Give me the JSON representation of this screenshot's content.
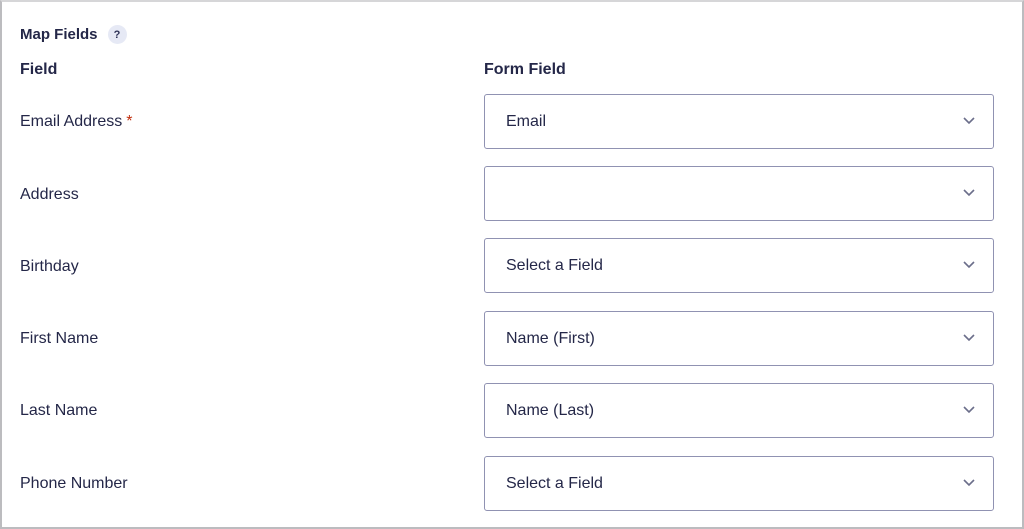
{
  "section": {
    "title": "Map Fields",
    "help_label": "?"
  },
  "columns": {
    "field": "Field",
    "form_field": "Form Field"
  },
  "required_marker": "*",
  "rows": [
    {
      "label": "Email Address",
      "value": "Email",
      "required": true
    },
    {
      "label": "Address",
      "value": ""
    },
    {
      "label": "Birthday",
      "value": "Select a Field"
    },
    {
      "label": "First Name",
      "value": "Name (First)"
    },
    {
      "label": "Last Name",
      "value": "Name (Last)"
    },
    {
      "label": "Phone Number",
      "value": "Select a Field"
    }
  ],
  "icons": {
    "help": "question-icon",
    "dropdown": "chevron-down-icon"
  },
  "colors": {
    "text": "#242748",
    "required": "#c02b0a",
    "border": "#9092b2",
    "help_bg": "#e6e9f5"
  }
}
